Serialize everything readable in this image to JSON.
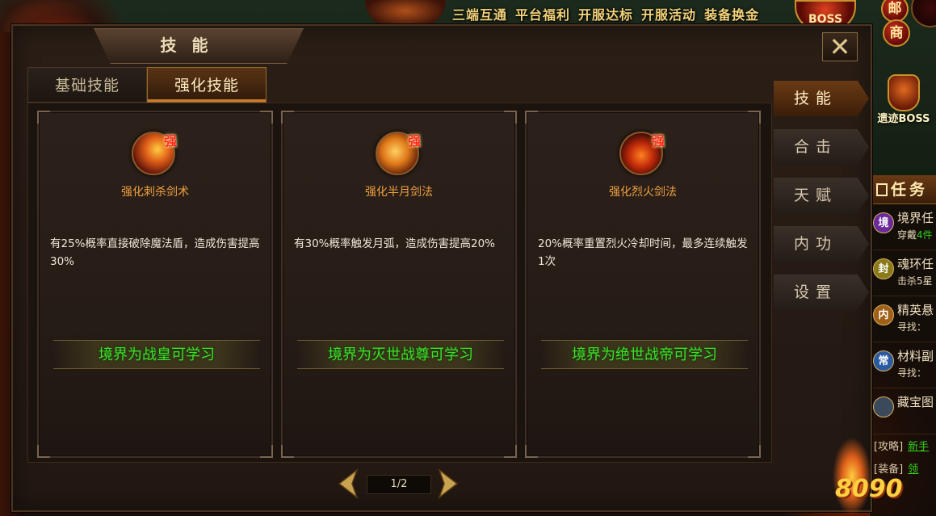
{
  "top_menu": [
    "三端互通",
    "平台福利",
    "开服达标",
    "开服活动",
    "装备换金"
  ],
  "boss_emblem": "BOSS",
  "round_buttons": {
    "mail": "邮",
    "shop": "商"
  },
  "relic_boss": {
    "label": "遗迹BOSS"
  },
  "window": {
    "title": "技 能",
    "close_icon": "close-x-icon"
  },
  "tabs": [
    {
      "label": "基础技能",
      "active": false
    },
    {
      "label": "强化技能",
      "active": true
    }
  ],
  "skills": [
    {
      "badge": "强",
      "name": "强化刺杀剑术",
      "description": "有25%概率直接破除魔法盾，造成伤害提高30%",
      "requirement": "境界为战皇可学习",
      "icon": "thrust-sword-icon"
    },
    {
      "badge": "强",
      "name": "强化半月剑法",
      "description": "有30%概率触发月弧，造成伤害提高20%",
      "requirement": "境界为灭世战尊可学习",
      "icon": "half-moon-icon"
    },
    {
      "badge": "强",
      "name": "强化烈火剑法",
      "description": "20%概率重置烈火冷却时间，最多连续触发1次",
      "requirement": "境界为绝世战帝可学习",
      "icon": "fire-sword-icon"
    }
  ],
  "pagination": {
    "text": "1/2",
    "current": 1,
    "total": 2
  },
  "side_tabs": [
    {
      "label": "技能",
      "active": true
    },
    {
      "label": "合击",
      "active": false
    },
    {
      "label": "天赋",
      "active": false
    },
    {
      "label": "内功",
      "active": false
    },
    {
      "label": "设置",
      "active": false
    }
  ],
  "quest_panel": {
    "title": "任务",
    "items": [
      {
        "badge": "境",
        "title": "境界任",
        "sub": "穿戴",
        "sub_hl": "4件",
        "color": "#6a2a9a"
      },
      {
        "badge": "封",
        "title": "魂环任",
        "sub": "击杀5星",
        "sub_hl": "",
        "color": "#8a7a1a"
      },
      {
        "badge": "内",
        "title": "精英悬",
        "sub": "寻找：",
        "sub_hl": "",
        "color": "#a06018"
      },
      {
        "badge": "常",
        "title": "材料副",
        "sub": "寻找：",
        "sub_hl": "",
        "color": "#2a5aa0"
      },
      {
        "badge": "",
        "title": "藏宝图",
        "sub": "",
        "sub_hl": "",
        "color": "#3a4a5a"
      }
    ],
    "guides": [
      {
        "tag": "[攻略]",
        "link": "新手"
      },
      {
        "tag": "[装备]",
        "link": "领"
      }
    ]
  },
  "watermark": "8090",
  "colors": {
    "accent_gold": "#c9922c",
    "learn_green": "#3ee02a",
    "skill_name_orange": "#f0a040",
    "strong_badge_red": "#ff2a14"
  }
}
